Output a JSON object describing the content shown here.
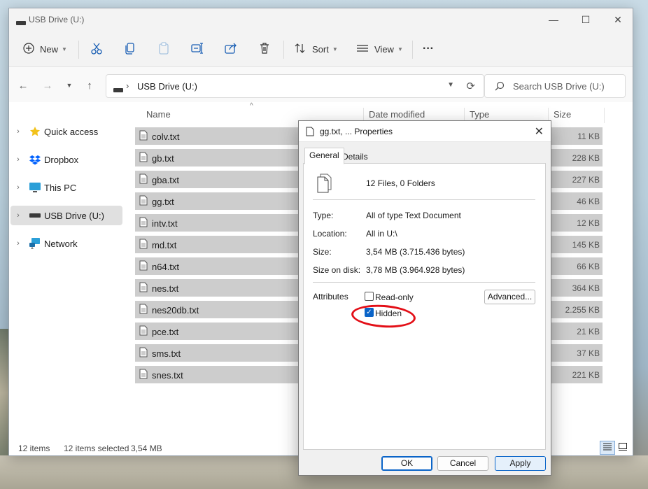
{
  "window": {
    "title": "USB Drive (U:)",
    "controls": {
      "minimize": "—",
      "maximize": "☐",
      "close": "✕"
    }
  },
  "toolbar": {
    "new_label": "New",
    "sort_label": "Sort",
    "view_label": "View",
    "more_label": "···"
  },
  "address": {
    "path_label": "USB Drive (U:)",
    "separator": "›",
    "search_placeholder": "Search USB Drive (U:)"
  },
  "sidebar": {
    "items": [
      {
        "label": "Quick access",
        "icon": "star-icon"
      },
      {
        "label": "Dropbox",
        "icon": "dropbox-icon"
      },
      {
        "label": "This PC",
        "icon": "monitor-icon"
      },
      {
        "label": "USB Drive (U:)",
        "icon": "drive-icon",
        "selected": true
      },
      {
        "label": "Network",
        "icon": "network-icon"
      }
    ]
  },
  "file_list": {
    "columns": {
      "name": "Name",
      "date": "Date modified",
      "type": "Type",
      "size": "Size"
    },
    "rows": [
      {
        "name": "colv.txt",
        "size": "11 KB"
      },
      {
        "name": "gb.txt",
        "size": "228 KB"
      },
      {
        "name": "gba.txt",
        "size": "227 KB"
      },
      {
        "name": "gg.txt",
        "size": "46 KB"
      },
      {
        "name": "intv.txt",
        "size": "12 KB"
      },
      {
        "name": "md.txt",
        "size": "145 KB"
      },
      {
        "name": "n64.txt",
        "size": "66 KB"
      },
      {
        "name": "nes.txt",
        "size": "364 KB"
      },
      {
        "name": "nes20db.txt",
        "size": "2.255 KB"
      },
      {
        "name": "pce.txt",
        "size": "21 KB"
      },
      {
        "name": "sms.txt",
        "size": "37 KB"
      },
      {
        "name": "snes.txt",
        "size": "221 KB"
      }
    ]
  },
  "status": {
    "count": "12 items",
    "selected": "12 items selected",
    "selected_size": "3,54 MB"
  },
  "dialog": {
    "title": "gg.txt, ... Properties",
    "tabs": [
      "General",
      "Details"
    ],
    "summary": "12 Files, 0 Folders",
    "fields": [
      {
        "label": "Type:",
        "value": "All of type Text Document"
      },
      {
        "label": "Location:",
        "value": "All in U:\\"
      },
      {
        "label": "Size:",
        "value": "3,54 MB (3.715.436 bytes)"
      },
      {
        "label": "Size on disk:",
        "value": "3,78 MB (3.964.928 bytes)"
      }
    ],
    "attributes_label": "Attributes",
    "readonly_label": "Read-only",
    "readonly_checked": false,
    "hidden_label": "Hidden",
    "hidden_checked": true,
    "advanced_label": "Advanced...",
    "ok_label": "OK",
    "cancel_label": "Cancel",
    "apply_label": "Apply",
    "close_symbol": "✕",
    "check_mark": "✓"
  }
}
